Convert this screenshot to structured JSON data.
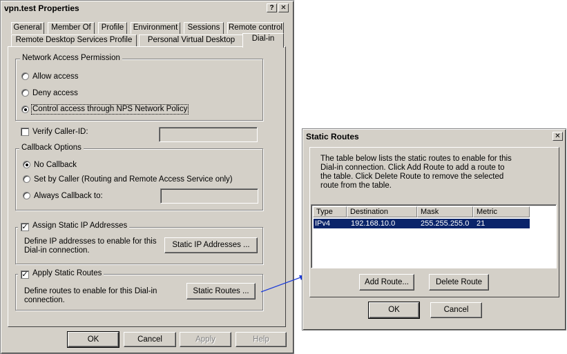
{
  "props": {
    "title": "vpn.test Properties",
    "help_glyph": "?",
    "close_glyph": "✕",
    "tabs_row1": [
      "General",
      "Member Of",
      "Profile",
      "Environment",
      "Sessions",
      "Remote control"
    ],
    "tabs_row2": [
      "Remote Desktop Services Profile",
      "Personal Virtual Desktop",
      "Dial-in"
    ],
    "nap": {
      "legend": "Network Access Permission",
      "allow": "Allow access",
      "deny": "Deny access",
      "control": "Control access through NPS Network Policy",
      "selected": "control"
    },
    "verify_caller_id": {
      "label": "Verify Caller-ID:",
      "checked": false,
      "value": ""
    },
    "callback": {
      "legend": "Callback Options",
      "no_callback": "No Callback",
      "set_by_caller": "Set by Caller (Routing and Remote Access Service only)",
      "always": "Always Callback to:",
      "always_value": "",
      "selected": "no_callback"
    },
    "static_ip": {
      "legend": "Assign Static IP Addresses",
      "checked": true,
      "desc_line1": "Define IP addresses to enable for this",
      "desc_line2": "Dial-in connection.",
      "button": "Static IP Addresses ..."
    },
    "static_routes": {
      "legend": "Apply Static Routes",
      "checked": true,
      "desc_line1": "Define routes to enable for this Dial-in",
      "desc_line2": "connection.",
      "button": "Static Routes ..."
    },
    "buttons": {
      "ok": "OK",
      "cancel": "Cancel",
      "apply": "Apply",
      "help": "Help"
    }
  },
  "routes_dialog": {
    "title": "Static Routes",
    "close_glyph": "✕",
    "desc_lines": [
      "The table below lists the static routes to enable for this",
      "Dial-in connection. Click Add Route to add a route to",
      "the table. Click Delete Route to remove the selected",
      "route from the table."
    ],
    "columns": [
      "Type",
      "Destination",
      "Mask",
      "Metric"
    ],
    "rows": [
      {
        "type": "IPv4",
        "destination": "192.168.10.0",
        "mask": "255.255.255.0",
        "metric": "21"
      }
    ],
    "add_button": "Add Route...",
    "delete_button": "Delete Route",
    "ok": "OK",
    "cancel": "Cancel"
  },
  "colors": {
    "selection": "#0a246a",
    "window_face": "#d4d0c8",
    "arrow": "#1f3ed8"
  }
}
